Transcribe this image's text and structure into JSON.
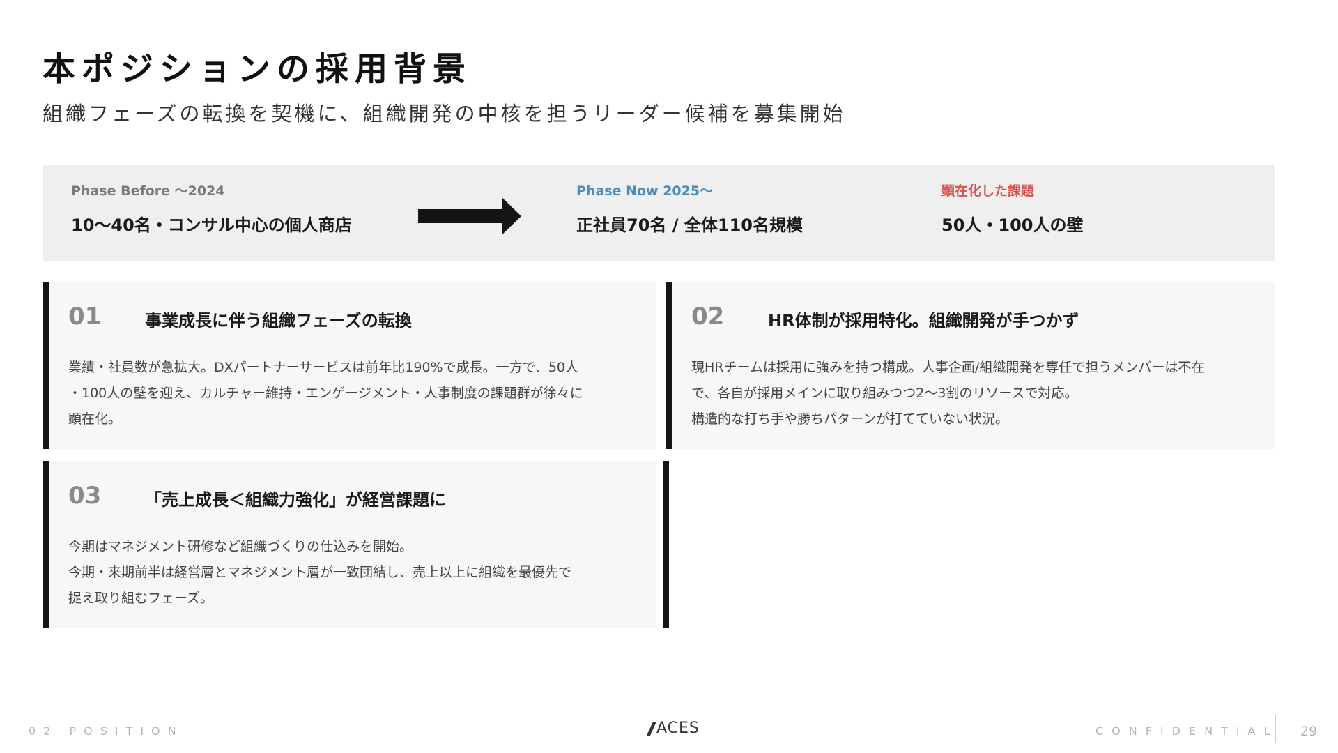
{
  "header": {
    "title": "本ポジションの採用背景",
    "subtitle": "組織フェーズの転換を契機に、組織開発の中核を担うリーダー候補を募集開始"
  },
  "phases": {
    "before": {
      "label": "Phase Before ～2024",
      "value": "10～40名・コンサル中心の個人商店"
    },
    "now": {
      "label": "Phase Now 2025～",
      "value": "正社員70名 / 全体110名規模"
    },
    "issue": {
      "label": "顕在化した課題",
      "value": "50人・100人の壁"
    },
    "colors": {
      "before": "#7a7a7a",
      "now": "#4a8db8",
      "issue": "#d9544f"
    },
    "arrow_icon": "arrow-right-icon"
  },
  "cards": [
    {
      "number": "01",
      "title": "事業成長に伴う組織フェーズの転換",
      "lines": [
        "業績・社員数が急拡大。DXパートナーサービスは前年比190%で成長。一方で、50人",
        "・100人の壁を迎え、カルチャー維持・エンゲージメント・人事制度の課題群が徐々に",
        "顕在化。"
      ]
    },
    {
      "number": "02",
      "title": "HR体制が採用特化。組織開発が手つかず",
      "lines": [
        "現HRチームは採用に強みを持つ構成。人事企画/組織開発を専任で担うメンバーは不在",
        "で、各自が採用メインに取り組みつつ2～3割のリソースで対応。",
        "構造的な打ち手や勝ちパターンが打てていない状況。"
      ]
    },
    {
      "number": "03",
      "title": "「売上成長＜組織力強化」が経営課題に",
      "lines": [
        "今期はマネジメント研修など組織づくりの仕込みを開始。",
        "今期・来期前半は経営層とマネジメント層が一致団結し、売上以上に組織を最優先で",
        "捉え取り組むフェーズ。"
      ]
    }
  ],
  "footer": {
    "section": "02 POSITION",
    "logo_text": "ACES",
    "confidential": "CONFIDENTIAL",
    "page": "29"
  }
}
